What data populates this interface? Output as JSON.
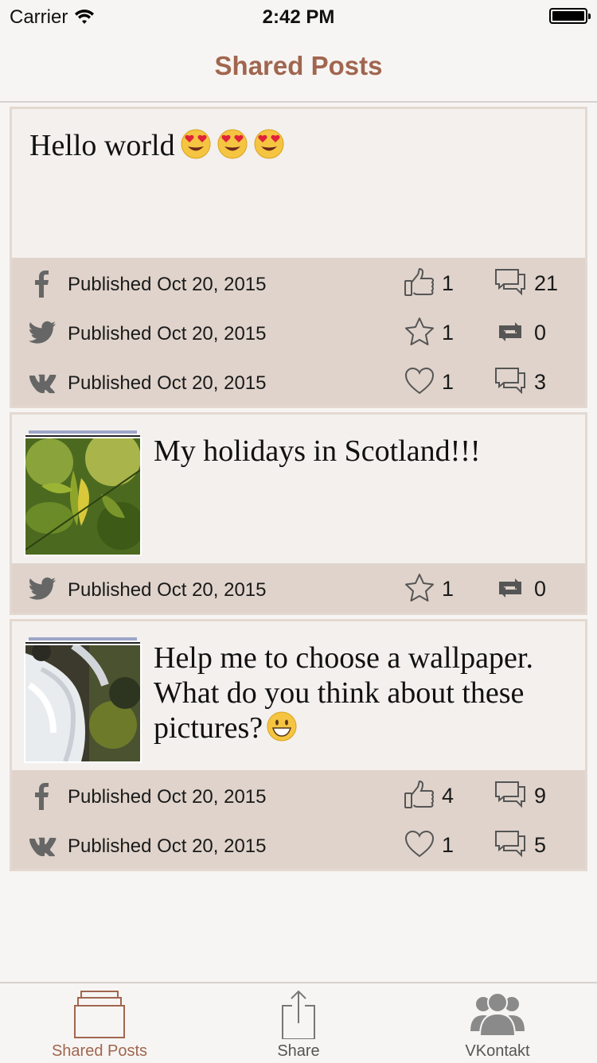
{
  "status_bar": {
    "carrier": "Carrier",
    "time": "2:42 PM"
  },
  "nav": {
    "title": "Shared Posts"
  },
  "colors": {
    "accent": "#a0664f",
    "card_bg": "#f3f0ed",
    "stats_bg": "#dfd3cb"
  },
  "posts": [
    {
      "text": "Hello world",
      "emojis": [
        "heart-eyes",
        "heart-eyes",
        "heart-eyes"
      ],
      "networks": [
        {
          "network": "facebook-icon",
          "published": "Published Oct 20, 2015",
          "stat1_icon": "thumbs-up-icon",
          "stat1": "1",
          "stat2_icon": "comments-icon",
          "stat2": "21"
        },
        {
          "network": "twitter-icon",
          "published": "Published Oct 20, 2015",
          "stat1_icon": "star-icon",
          "stat1": "1",
          "stat2_icon": "retweet-icon",
          "stat2": "0"
        },
        {
          "network": "vk-icon",
          "published": "Published Oct 20, 2015",
          "stat1_icon": "heart-icon",
          "stat1": "1",
          "stat2_icon": "comments-icon",
          "stat2": "3"
        }
      ]
    },
    {
      "text": "My holidays in Scotland!!!",
      "thumbnail": "leaf-photo",
      "networks": [
        {
          "network": "twitter-icon",
          "published": "Published Oct 20, 2015",
          "stat1_icon": "star-icon",
          "stat1": "1",
          "stat2_icon": "retweet-icon",
          "stat2": "0"
        }
      ]
    },
    {
      "text_line1": "Help me to choose a wallpaper.",
      "text_line2": "What do you think about these",
      "text_line3": "pictures?",
      "thumbnail": "waterfall-photo",
      "emojis": [
        "grinning"
      ],
      "networks": [
        {
          "network": "facebook-icon",
          "published": "Published Oct 20, 2015",
          "stat1_icon": "thumbs-up-icon",
          "stat1": "4",
          "stat2_icon": "comments-icon",
          "stat2": "9"
        },
        {
          "network": "vk-icon",
          "published": "Published Oct 20, 2015",
          "stat1_icon": "heart-icon",
          "stat1": "1",
          "stat2_icon": "comments-icon",
          "stat2": "5"
        }
      ]
    }
  ],
  "tabs": [
    {
      "label": "Shared Posts",
      "icon": "stacked-posts-icon",
      "active": true
    },
    {
      "label": "Share",
      "icon": "share-icon",
      "active": false
    },
    {
      "label": "VKontakt",
      "icon": "people-icon",
      "active": false
    }
  ]
}
